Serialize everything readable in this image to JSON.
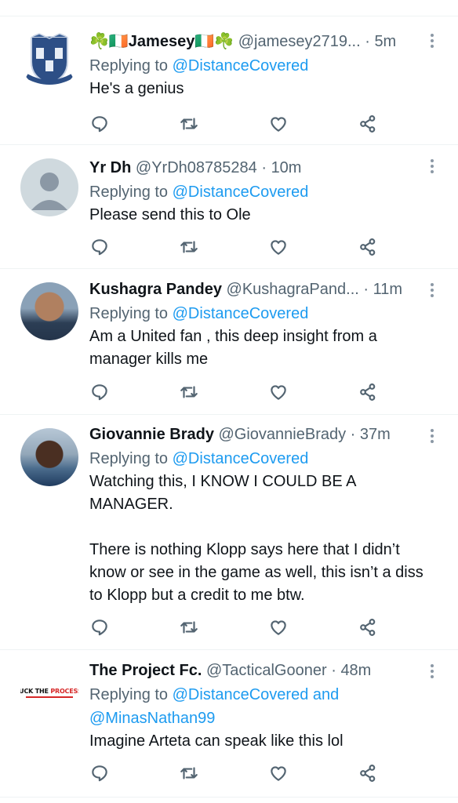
{
  "tweets": [
    {
      "name": "☘️🇮🇪Jamesey🇮🇪☘️",
      "handle": "@jamesey2719...",
      "dot": "·",
      "time": "5m",
      "replying_label": "Replying to",
      "mentions": "@DistanceCovered",
      "text": "He's a genius",
      "avatar": "crest-avatar"
    },
    {
      "name": "Yr Dh",
      "handle": "@YrDh08785284",
      "dot": "·",
      "time": "10m",
      "replying_label": "Replying to",
      "mentions": "@DistanceCovered",
      "text": "Please send this to Ole",
      "avatar": "default-avatar"
    },
    {
      "name": "Kushagra Pandey",
      "handle": "@KushagraPand...",
      "dot": "·",
      "time": "11m",
      "replying_label": "Replying to",
      "mentions": "@DistanceCovered",
      "text": "Am a United fan , this deep insight from a manager kills me",
      "avatar": "photo-avatar"
    },
    {
      "name": "Giovannie Brady",
      "handle": "@GiovannieBrady",
      "dot": "·",
      "time": "37m",
      "replying_label": "Replying to",
      "mentions": "@DistanceCovered",
      "text": "Watching this, I KNOW I COULD BE A MANAGER.\n\nThere is nothing Klopp says here that I didn’t know or see in the game as well, this isn’t a diss to Klopp but a credit to me btw.",
      "avatar": "photo-avatar"
    },
    {
      "name": "The Project Fc.",
      "handle": "@TacticalGooner",
      "dot": "·",
      "time": "48m",
      "replying_label": "Replying to",
      "mentions": "@DistanceCovered and @MinasNathan99",
      "text": "Imagine Arteta can speak like this lol",
      "avatar": "logo-avatar",
      "avatar_text_a": "FUCK THE ",
      "avatar_text_b": "PROCESS."
    }
  ],
  "icons": [
    "reply-icon",
    "retweet-icon",
    "like-icon",
    "share-icon",
    "more-icon"
  ],
  "colors": {
    "accent": "#1d9bf0",
    "secondary_text": "#536471",
    "primary_text": "#0f1419",
    "divider": "#eff3f4"
  }
}
